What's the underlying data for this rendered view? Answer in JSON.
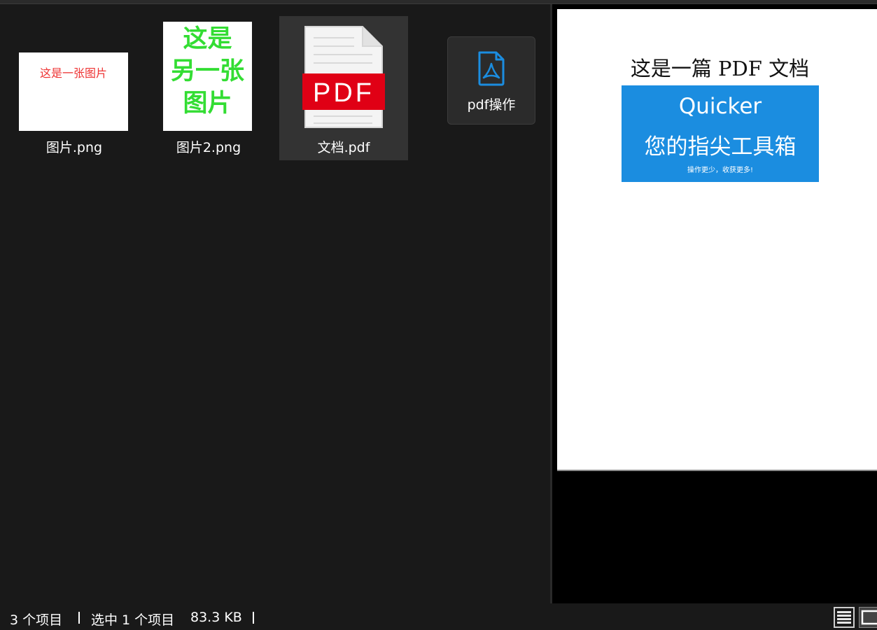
{
  "files": [
    {
      "name": "图片.png",
      "thumbnail_text": "这是一张图片",
      "thumbnail_color": "#ee3333"
    },
    {
      "name": "图片2.png",
      "thumbnail_text": "这是\n另一张\n图片",
      "thumbnail_color": "#33dd33"
    },
    {
      "name": "文档.pdf",
      "icon_label": "PDF",
      "selected": true
    }
  ],
  "action_tile": {
    "label": "pdf操作",
    "icon": "pdf-file-icon",
    "icon_color": "#1b8de0"
  },
  "preview": {
    "title": "这是一篇 PDF 文档",
    "banner": {
      "line1": "Quicker",
      "line2": "您的指尖工具箱",
      "line3": "操作更少，收获更多!",
      "color": "#1b8de0"
    }
  },
  "status": {
    "item_count": "3 个项目",
    "selected_count": "选中 1 个项目",
    "selected_size": "83.3 KB"
  },
  "view_buttons": [
    {
      "name": "details-view",
      "icon": "details-list-icon"
    },
    {
      "name": "preview-view",
      "icon": "preview-pane-icon",
      "active": true
    }
  ]
}
